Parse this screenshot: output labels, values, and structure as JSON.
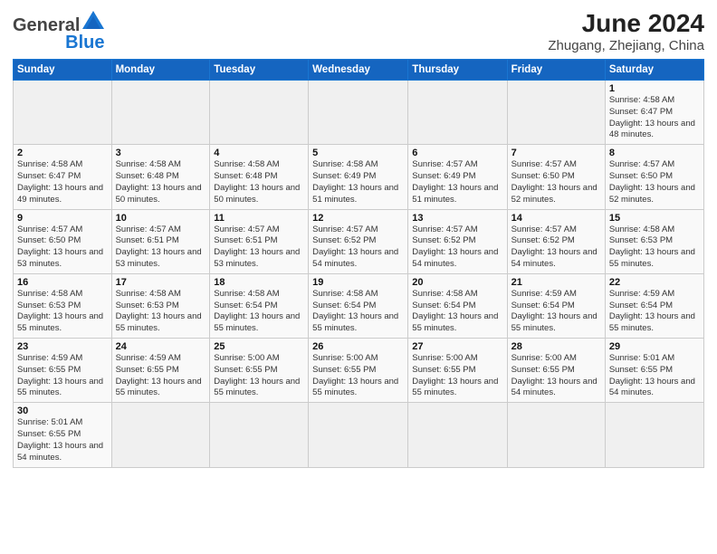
{
  "header": {
    "logo_general": "General",
    "logo_blue": "Blue",
    "title": "June 2024",
    "subtitle": "Zhugang, Zhejiang, China"
  },
  "days_of_week": [
    "Sunday",
    "Monday",
    "Tuesday",
    "Wednesday",
    "Thursday",
    "Friday",
    "Saturday"
  ],
  "weeks": [
    [
      {
        "day": "",
        "info": ""
      },
      {
        "day": "",
        "info": ""
      },
      {
        "day": "",
        "info": ""
      },
      {
        "day": "",
        "info": ""
      },
      {
        "day": "",
        "info": ""
      },
      {
        "day": "",
        "info": ""
      },
      {
        "day": "1",
        "info": "Sunrise: 4:58 AM\nSunset: 6:47 PM\nDaylight: 13 hours and 48 minutes."
      }
    ],
    [
      {
        "day": "2",
        "info": "Sunrise: 4:58 AM\nSunset: 6:47 PM\nDaylight: 13 hours and 49 minutes."
      },
      {
        "day": "3",
        "info": "Sunrise: 4:58 AM\nSunset: 6:48 PM\nDaylight: 13 hours and 50 minutes."
      },
      {
        "day": "4",
        "info": "Sunrise: 4:58 AM\nSunset: 6:48 PM\nDaylight: 13 hours and 50 minutes."
      },
      {
        "day": "5",
        "info": "Sunrise: 4:58 AM\nSunset: 6:49 PM\nDaylight: 13 hours and 51 minutes."
      },
      {
        "day": "6",
        "info": "Sunrise: 4:57 AM\nSunset: 6:49 PM\nDaylight: 13 hours and 51 minutes."
      },
      {
        "day": "7",
        "info": "Sunrise: 4:57 AM\nSunset: 6:50 PM\nDaylight: 13 hours and 52 minutes."
      },
      {
        "day": "8",
        "info": "Sunrise: 4:57 AM\nSunset: 6:50 PM\nDaylight: 13 hours and 52 minutes."
      }
    ],
    [
      {
        "day": "9",
        "info": "Sunrise: 4:57 AM\nSunset: 6:50 PM\nDaylight: 13 hours and 53 minutes."
      },
      {
        "day": "10",
        "info": "Sunrise: 4:57 AM\nSunset: 6:51 PM\nDaylight: 13 hours and 53 minutes."
      },
      {
        "day": "11",
        "info": "Sunrise: 4:57 AM\nSunset: 6:51 PM\nDaylight: 13 hours and 53 minutes."
      },
      {
        "day": "12",
        "info": "Sunrise: 4:57 AM\nSunset: 6:52 PM\nDaylight: 13 hours and 54 minutes."
      },
      {
        "day": "13",
        "info": "Sunrise: 4:57 AM\nSunset: 6:52 PM\nDaylight: 13 hours and 54 minutes."
      },
      {
        "day": "14",
        "info": "Sunrise: 4:57 AM\nSunset: 6:52 PM\nDaylight: 13 hours and 54 minutes."
      },
      {
        "day": "15",
        "info": "Sunrise: 4:58 AM\nSunset: 6:53 PM\nDaylight: 13 hours and 55 minutes."
      }
    ],
    [
      {
        "day": "16",
        "info": "Sunrise: 4:58 AM\nSunset: 6:53 PM\nDaylight: 13 hours and 55 minutes."
      },
      {
        "day": "17",
        "info": "Sunrise: 4:58 AM\nSunset: 6:53 PM\nDaylight: 13 hours and 55 minutes."
      },
      {
        "day": "18",
        "info": "Sunrise: 4:58 AM\nSunset: 6:54 PM\nDaylight: 13 hours and 55 minutes."
      },
      {
        "day": "19",
        "info": "Sunrise: 4:58 AM\nSunset: 6:54 PM\nDaylight: 13 hours and 55 minutes."
      },
      {
        "day": "20",
        "info": "Sunrise: 4:58 AM\nSunset: 6:54 PM\nDaylight: 13 hours and 55 minutes."
      },
      {
        "day": "21",
        "info": "Sunrise: 4:59 AM\nSunset: 6:54 PM\nDaylight: 13 hours and 55 minutes."
      },
      {
        "day": "22",
        "info": "Sunrise: 4:59 AM\nSunset: 6:54 PM\nDaylight: 13 hours and 55 minutes."
      }
    ],
    [
      {
        "day": "23",
        "info": "Sunrise: 4:59 AM\nSunset: 6:55 PM\nDaylight: 13 hours and 55 minutes."
      },
      {
        "day": "24",
        "info": "Sunrise: 4:59 AM\nSunset: 6:55 PM\nDaylight: 13 hours and 55 minutes."
      },
      {
        "day": "25",
        "info": "Sunrise: 5:00 AM\nSunset: 6:55 PM\nDaylight: 13 hours and 55 minutes."
      },
      {
        "day": "26",
        "info": "Sunrise: 5:00 AM\nSunset: 6:55 PM\nDaylight: 13 hours and 55 minutes."
      },
      {
        "day": "27",
        "info": "Sunrise: 5:00 AM\nSunset: 6:55 PM\nDaylight: 13 hours and 55 minutes."
      },
      {
        "day": "28",
        "info": "Sunrise: 5:00 AM\nSunset: 6:55 PM\nDaylight: 13 hours and 54 minutes."
      },
      {
        "day": "29",
        "info": "Sunrise: 5:01 AM\nSunset: 6:55 PM\nDaylight: 13 hours and 54 minutes."
      }
    ],
    [
      {
        "day": "30",
        "info": "Sunrise: 5:01 AM\nSunset: 6:55 PM\nDaylight: 13 hours and 54 minutes."
      },
      {
        "day": "",
        "info": ""
      },
      {
        "day": "",
        "info": ""
      },
      {
        "day": "",
        "info": ""
      },
      {
        "day": "",
        "info": ""
      },
      {
        "day": "",
        "info": ""
      },
      {
        "day": "",
        "info": ""
      }
    ]
  ]
}
